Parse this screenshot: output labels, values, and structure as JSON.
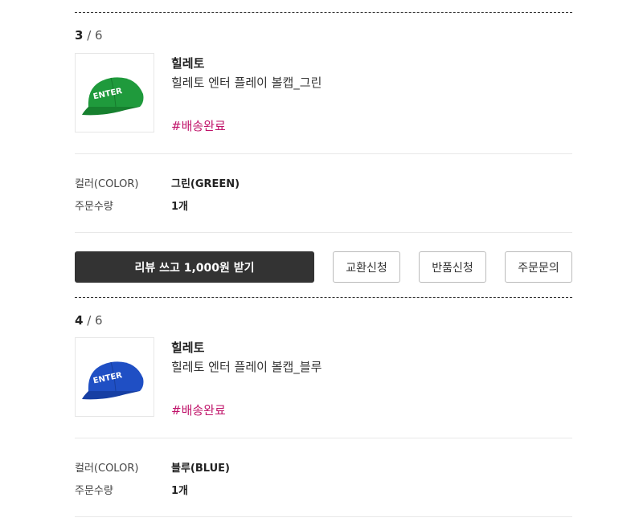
{
  "items": [
    {
      "counter_current": "3",
      "counter_total": "6",
      "brand": "힐레토",
      "name": "힐레토 엔터 플레이 볼캡_그린",
      "status": "#배송완료",
      "color_label": "컬러(COLOR)",
      "color_value": "그린(GREEN)",
      "qty_label": "주문수량",
      "qty_value": "1개",
      "cap_color": "#1f9a3c",
      "cap_text": "ENTER"
    },
    {
      "counter_current": "4",
      "counter_total": "6",
      "brand": "힐레토",
      "name": "힐레토 엔터 플레이 볼캡_블루",
      "status": "#배송완료",
      "color_label": "컬러(COLOR)",
      "color_value": "블루(BLUE)",
      "qty_label": "주문수량",
      "qty_value": "1개",
      "cap_color": "#1f4fc4",
      "cap_text": "ENTER"
    }
  ],
  "actions": {
    "review": "리뷰 쓰고 1,000원 받기",
    "exchange": "교환신청",
    "return": "반품신청",
    "inquiry": "주문문의"
  },
  "colors": {
    "status_pink": "#c0146a",
    "review_button_bg": "#333333"
  }
}
